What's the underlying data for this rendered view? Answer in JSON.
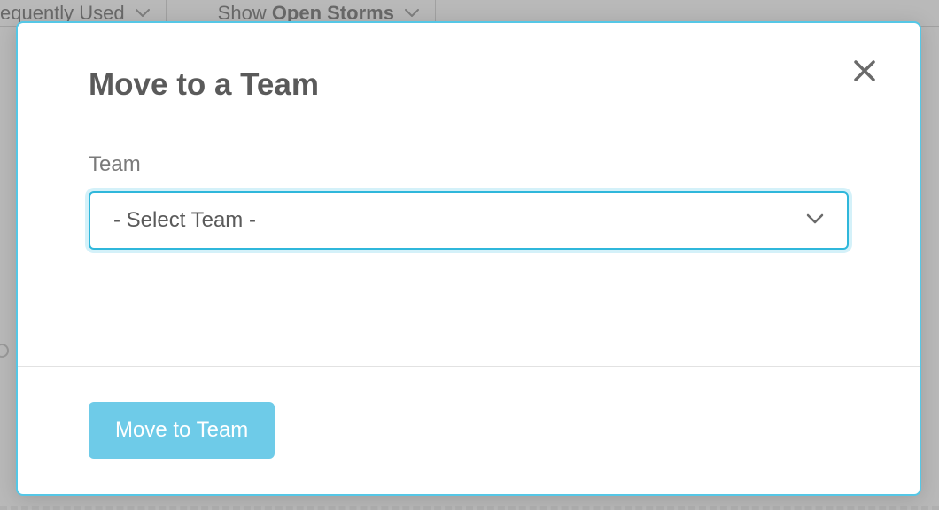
{
  "background": {
    "filter1_prefix": "equently Used",
    "filter2_prefix": "Show ",
    "filter2_bold": "Open Storms"
  },
  "modal": {
    "title": "Move to a Team",
    "field_label": "Team",
    "select_placeholder": "- Select Team -",
    "submit_label": "Move to Team"
  }
}
